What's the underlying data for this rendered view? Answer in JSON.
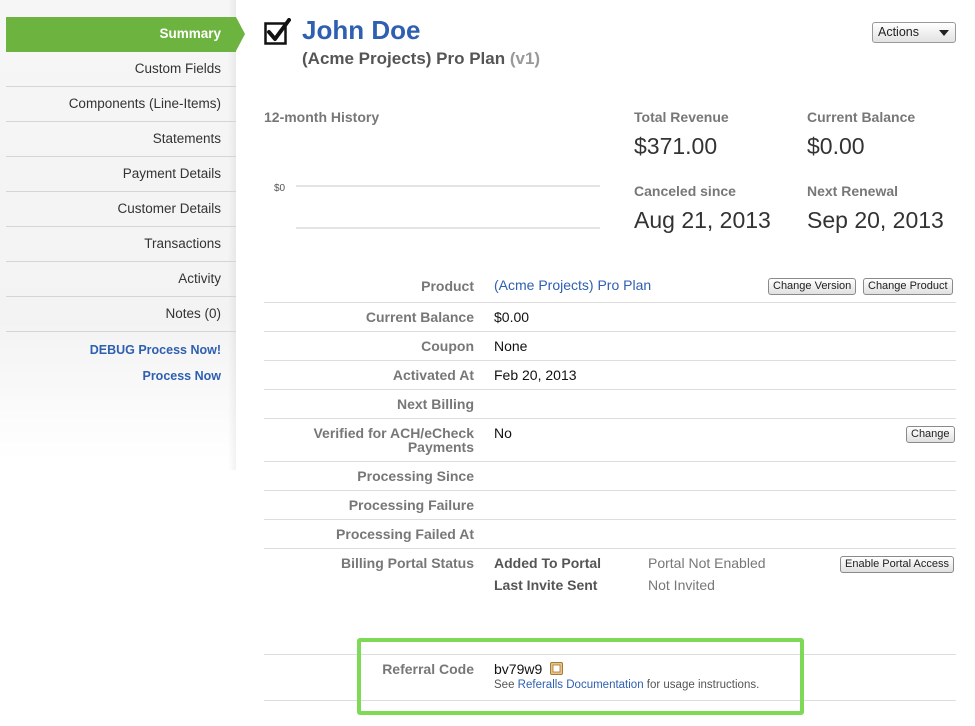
{
  "sidebar": {
    "items": [
      {
        "label": "Summary"
      },
      {
        "label": "Custom Fields"
      },
      {
        "label": "Components (Line-Items)"
      },
      {
        "label": "Statements"
      },
      {
        "label": "Payment Details"
      },
      {
        "label": "Customer Details"
      },
      {
        "label": "Transactions"
      },
      {
        "label": "Activity"
      },
      {
        "label": "Notes (0)"
      }
    ],
    "debug_link": "DEBUG Process Now!",
    "process_link": "Process Now"
  },
  "header": {
    "customer_name": "John Doe",
    "plan": "(Acme Projects) Pro Plan",
    "version": "(v1)",
    "actions_label": "Actions"
  },
  "history": {
    "title": "12-month History",
    "y_tick": "$0"
  },
  "stats": {
    "total_revenue_label": "Total Revenue",
    "total_revenue": "$371.00",
    "current_balance_label": "Current Balance",
    "current_balance": "$0.00",
    "canceled_label": "Canceled since",
    "canceled": "Aug 21, 2013",
    "next_renewal_label": "Next Renewal",
    "next_renewal": "Sep 20, 2013"
  },
  "details": {
    "product_label": "Product",
    "product_value": "(Acme Projects) Pro Plan",
    "change_version": "Change Version",
    "change_product": "Change Product",
    "balance_label": "Current Balance",
    "balance_value": "$0.00",
    "coupon_label": "Coupon",
    "coupon_value": "None",
    "activated_label": "Activated At",
    "activated_value": "Feb 20, 2013",
    "next_billing_label": "Next Billing",
    "ach_label_1": "Verified for ACH/eCheck",
    "ach_label_2": "Payments",
    "ach_value": "No",
    "change": "Change",
    "proc_since_label": "Processing Since",
    "proc_failure_label": "Processing Failure",
    "proc_failed_at_label": "Processing Failed At",
    "portal_label": "Billing Portal Status",
    "added_to_portal": "Added To Portal",
    "portal_not_enabled": "Portal Not Enabled",
    "last_invite": "Last Invite Sent",
    "not_invited": "Not Invited",
    "enable_portal": "Enable Portal Access",
    "referral_label": "Referral Code",
    "referral_value": "bv79w9",
    "note_prefix": "See",
    "note_link": "Referalls Documentation",
    "note_suffix": "for usage instructions."
  },
  "colors": {
    "accent": "#6db33f",
    "link": "#2e5fb0",
    "highlight": "#7ed957"
  }
}
